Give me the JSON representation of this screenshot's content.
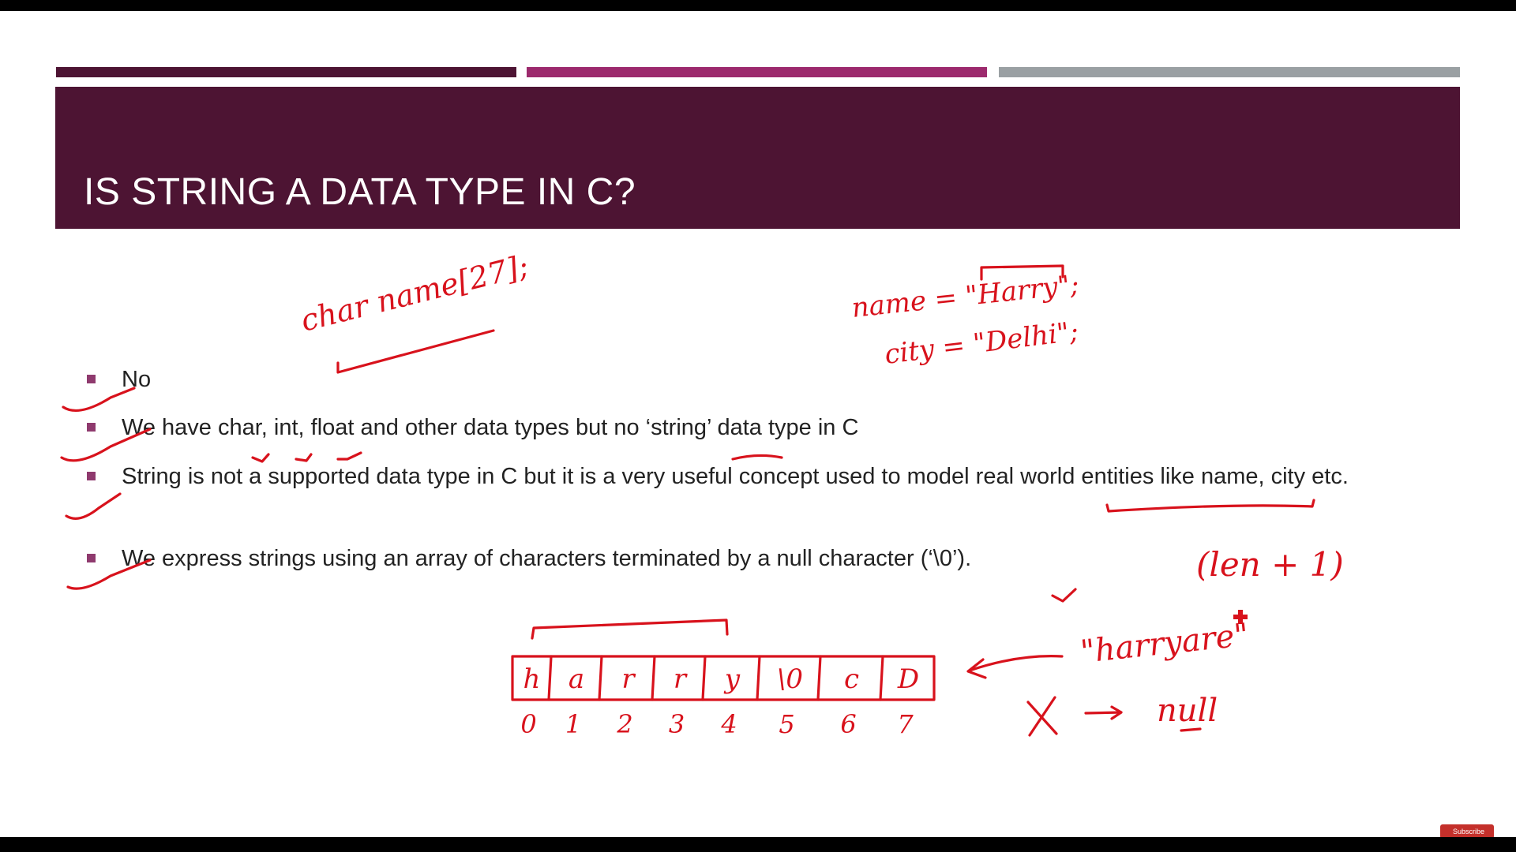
{
  "slide": {
    "title": "IS STRING A DATA TYPE IN C?",
    "colors": {
      "title_band": "#4d1433",
      "bar_1": "#4d1433",
      "bar_2": "#9c2a6d",
      "bar_3": "#9aa0a3",
      "ink": "#d8121c"
    },
    "bullets": [
      "No",
      "We have char, int, float and other data types but no ‘string’ data type in C",
      "String is not a supported data type in C but it is a very useful concept used to model real world entities like name, city etc.",
      "We express strings using an array of characters terminated by a null character (‘\\0’)."
    ]
  },
  "annotations": {
    "declaration": "char name[27];",
    "assign_name": "name = \"Harry\";",
    "assign_city": "city = \"Delhi\";",
    "length_note": "(len + 1)",
    "string_literal": "\"harryare\"",
    "null_note": "null",
    "array_cells": [
      "h",
      "a",
      "r",
      "r",
      "y",
      "\\0",
      "c",
      "D"
    ],
    "array_indices": [
      "0",
      "1",
      "2",
      "3",
      "4",
      "5",
      "6",
      "7"
    ]
  },
  "overlay": {
    "subscribe_label": "Subscribe"
  }
}
